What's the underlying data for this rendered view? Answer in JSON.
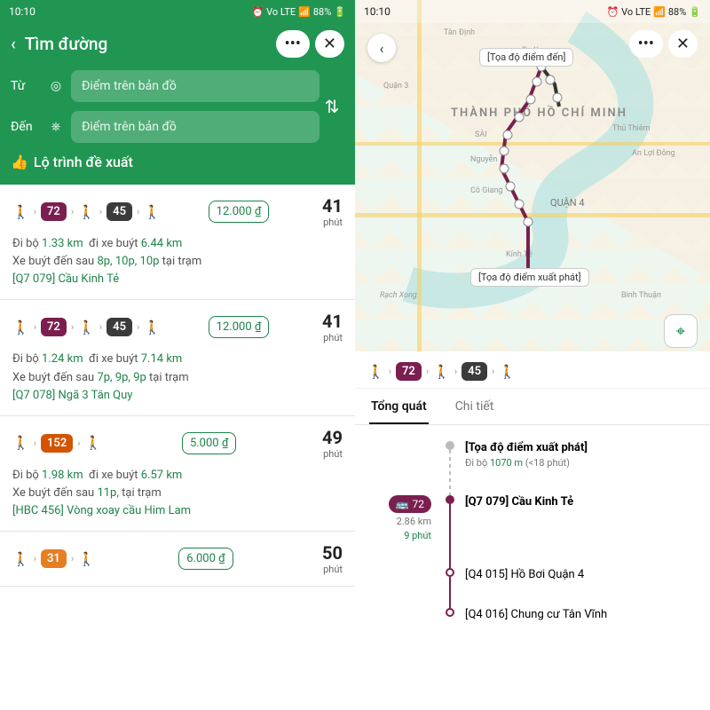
{
  "status": {
    "time": "10:10",
    "battery": "88%",
    "net": "Vo LTE"
  },
  "left": {
    "title": "Tìm đường",
    "from_label": "Từ",
    "to_label": "Đến",
    "placeholder_from": "Điểm trên bản đồ",
    "placeholder_to": "Điểm trên bản đồ",
    "section": "Lộ trình đề xuất",
    "routes": [
      {
        "chips": [
          {
            "t": "walk"
          },
          {
            "t": "bus",
            "label": "72",
            "c": "purple"
          },
          {
            "t": "walk"
          },
          {
            "t": "bus",
            "label": "45",
            "c": "dark"
          },
          {
            "t": "walk"
          }
        ],
        "price": "12.000 ₫",
        "minutes": "41",
        "unit": "phút",
        "walk_label": "Đi bộ",
        "walk_dist": "1.33 km",
        "bus_label": "đi xe buýt",
        "bus_dist": "6.44 km",
        "arrive_label": "Xe buýt đến sau",
        "arrive_times": "8p, 10p, 10p",
        "at_label": "tại trạm",
        "station": "[Q7 079] Cầu Kinh Tẻ"
      },
      {
        "chips": [
          {
            "t": "walk"
          },
          {
            "t": "bus",
            "label": "72",
            "c": "purple"
          },
          {
            "t": "walk"
          },
          {
            "t": "bus",
            "label": "45",
            "c": "dark"
          },
          {
            "t": "walk"
          }
        ],
        "price": "12.000 ₫",
        "minutes": "41",
        "unit": "phút",
        "walk_label": "Đi bộ",
        "walk_dist": "1.24 km",
        "bus_label": "đi xe buýt",
        "bus_dist": "7.14 km",
        "arrive_label": "Xe buýt đến sau",
        "arrive_times": "7p, 9p, 9p",
        "at_label": "tại trạm",
        "station": "[Q7 078] Ngã 3 Tân Quy"
      },
      {
        "chips": [
          {
            "t": "walk"
          },
          {
            "t": "bus",
            "label": "152",
            "c": "orange"
          },
          {
            "t": "walk"
          }
        ],
        "price": "5.000 ₫",
        "minutes": "49",
        "unit": "phút",
        "walk_label": "Đi bộ",
        "walk_dist": "1.98 km",
        "bus_label": "đi xe buýt",
        "bus_dist": "6.57 km",
        "arrive_label": "Xe buýt đến sau",
        "arrive_times": "11p,",
        "at_label": "tại trạm",
        "station": "[HBC 456] Vòng xoay cầu Him Lam"
      },
      {
        "chips": [
          {
            "t": "walk"
          },
          {
            "t": "bus",
            "label": "31",
            "c": "orange2"
          },
          {
            "t": "walk"
          }
        ],
        "price": "6.000 ₫",
        "minutes": "50",
        "unit": "phút"
      }
    ]
  },
  "right": {
    "dest_callout": "[Tọa độ điểm đến]",
    "origin_callout": "[Tọa độ điểm xuất phát]",
    "city_label": "THÀNH PHỐ HỒ CHÍ MINH",
    "labels": [
      "Tân Định",
      "Phường",
      "Đa Kao",
      "Quận 3",
      "SÀI",
      "Thủ Thiêm",
      "Nguyễn",
      "Cô Giang",
      "QUẬN 4",
      "Binh Thuận",
      "Kính Tẻ",
      "Rạch Xong",
      "An Lợi Đông"
    ],
    "chips": [
      {
        "t": "walk"
      },
      {
        "t": "bus",
        "label": "72",
        "c": "purple"
      },
      {
        "t": "walk"
      },
      {
        "t": "bus",
        "label": "45",
        "c": "dark"
      },
      {
        "t": "walk"
      }
    ],
    "tabs": {
      "overview": "Tổng quát",
      "detail": "Chi tiết"
    },
    "timeline": {
      "start_title": "[Tọa độ điểm xuất phát]",
      "start_walk_label": "Đi bộ",
      "start_walk_dist": "1070 m",
      "start_walk_time": "(<18 phút)",
      "bus_code": "72",
      "bus_dist": "2.86 km",
      "bus_time": "9 phút",
      "stop1": "[Q7 079] Cầu Kinh Tẻ",
      "stop2": "[Q4 015] Hồ Bơi Quận 4",
      "stop3": "[Q4 016] Chung cư Tân Vĩnh"
    }
  }
}
